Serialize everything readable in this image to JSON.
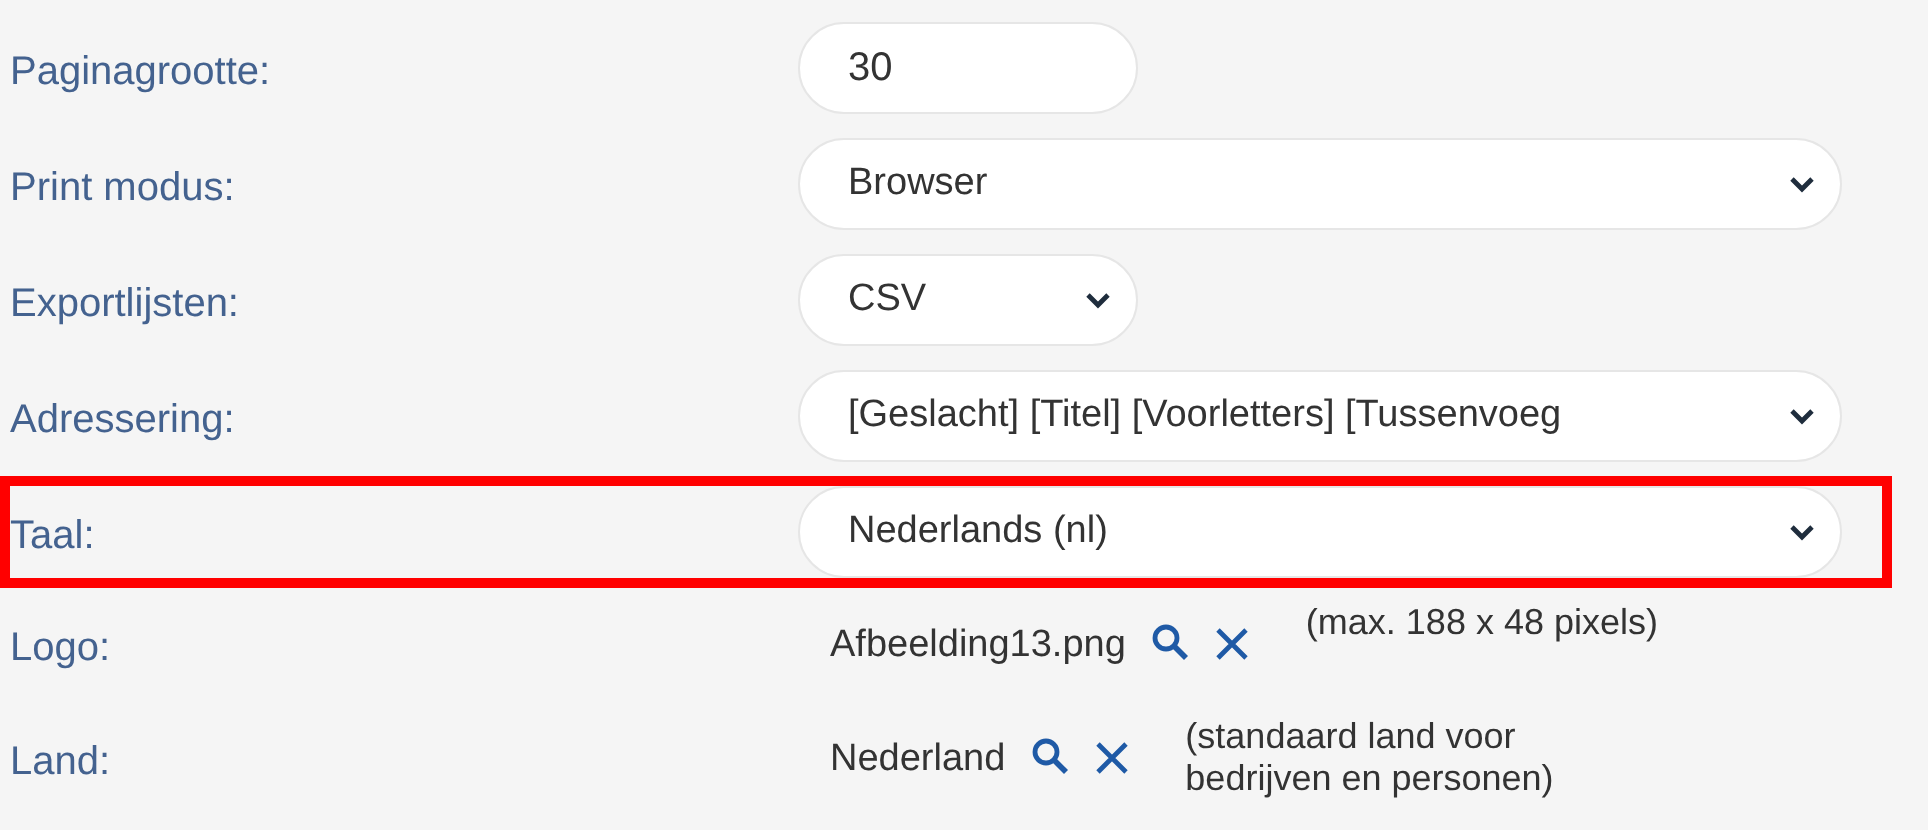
{
  "settings": [
    {
      "kind": "input",
      "label": "Paginagrootte:",
      "value": "30",
      "wide": false,
      "highlighted": false
    },
    {
      "kind": "select",
      "label": "Print modus:",
      "value": "Browser",
      "wide": true,
      "highlighted": false
    },
    {
      "kind": "select",
      "label": "Exportlijsten:",
      "value": "CSV",
      "wide": false,
      "highlighted": false
    },
    {
      "kind": "select",
      "label": "Adressering:",
      "value": "[Geslacht] [Titel] [Voorletters] [Tussenvoeg",
      "wide": true,
      "highlighted": false
    },
    {
      "kind": "select",
      "label": "Taal:",
      "value": "Nederlands (nl)",
      "wide": true,
      "highlighted": true
    },
    {
      "kind": "lookup",
      "label": "Logo:",
      "value": "Afbeelding13.png",
      "hint": "(max. 188 x 48 pixels)",
      "highlighted": false
    },
    {
      "kind": "lookup",
      "label": "Land:",
      "value": "Nederland",
      "hint": "(standaard land voor bedrijven en personen)",
      "highlighted": false
    }
  ]
}
